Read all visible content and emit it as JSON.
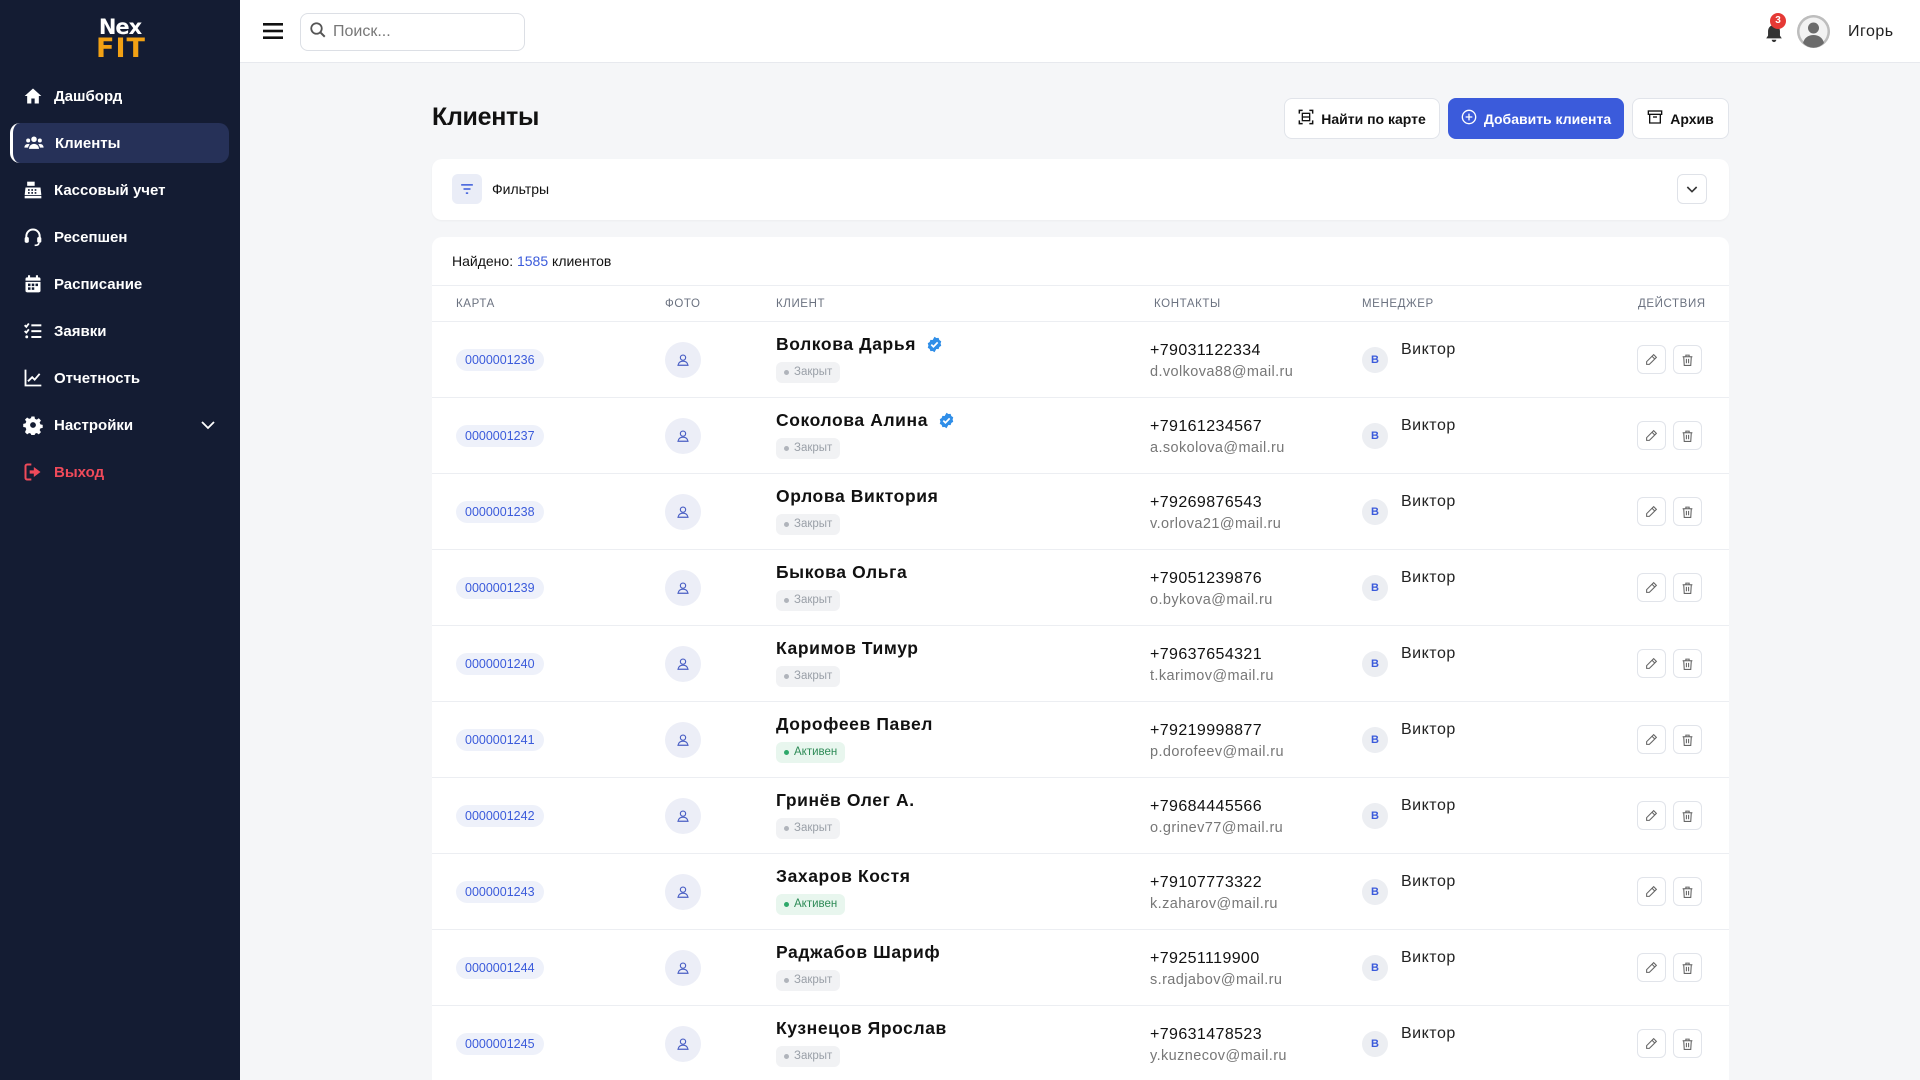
{
  "brand": {
    "line1": "Nex",
    "line2": "FIT"
  },
  "sidebar": {
    "items": [
      {
        "label": "Дашборд",
        "icon": "home-icon"
      },
      {
        "label": "Клиенты",
        "icon": "users-icon",
        "active": true
      },
      {
        "label": "Кассовый учет",
        "icon": "cash-register-icon"
      },
      {
        "label": "Ресепшен",
        "icon": "headset-icon"
      },
      {
        "label": "Расписание",
        "icon": "calendar-icon"
      },
      {
        "label": "Заявки",
        "icon": "list-check-icon"
      },
      {
        "label": "Отчетность",
        "icon": "chart-line-icon"
      },
      {
        "label": "Настройки",
        "icon": "gear-icon",
        "expandable": true
      },
      {
        "label": "Выход",
        "icon": "logout-icon"
      }
    ]
  },
  "topbar": {
    "search_placeholder": "Поиск...",
    "notifications_count": "3",
    "username": "Игорь"
  },
  "page": {
    "title": "Клиенты",
    "btn_find_card": "Найти по карте",
    "btn_add_client": "Добавить клиента",
    "btn_archive": "Архив"
  },
  "filters": {
    "label": "Фильтры"
  },
  "summary": {
    "prefix": "Найдено:",
    "count": "1585",
    "suffix": "клиентов"
  },
  "table": {
    "headers": {
      "card": "КАРТА",
      "photo": "ФОТО",
      "client": "КЛИЕНТ",
      "contacts": "КОНТАКТЫ",
      "manager": "МЕНЕДЖЕР",
      "actions": "ДЕЙСТВИЯ"
    },
    "rows": [
      {
        "card": "0000001236",
        "name": "Волкова Дарья",
        "verified": true,
        "status": "Закрыт",
        "status_type": "closed",
        "phone": "+79031122334",
        "email": "d.volkova88@mail.ru",
        "manager_initial": "В",
        "manager": "Виктор"
      },
      {
        "card": "0000001237",
        "name": "Соколова Алина",
        "verified": true,
        "status": "Закрыт",
        "status_type": "closed",
        "phone": "+79161234567",
        "email": "a.sokolova@mail.ru",
        "manager_initial": "В",
        "manager": "Виктор"
      },
      {
        "card": "0000001238",
        "name": "Орлова Виктория",
        "verified": false,
        "status": "Закрыт",
        "status_type": "closed",
        "phone": "+79269876543",
        "email": "v.orlova21@mail.ru",
        "manager_initial": "В",
        "manager": "Виктор"
      },
      {
        "card": "0000001239",
        "name": "Быкова Ольга",
        "verified": false,
        "status": "Закрыт",
        "status_type": "closed",
        "phone": "+79051239876",
        "email": "o.bykova@mail.ru",
        "manager_initial": "В",
        "manager": "Виктор"
      },
      {
        "card": "0000001240",
        "name": "Каримов Тимур",
        "verified": false,
        "status": "Закрыт",
        "status_type": "closed",
        "phone": "+79637654321",
        "email": "t.karimov@mail.ru",
        "manager_initial": "В",
        "manager": "Виктор"
      },
      {
        "card": "0000001241",
        "name": "Дорофеев Павел",
        "verified": false,
        "status": "Активен",
        "status_type": "active",
        "phone": "+79219998877",
        "email": "p.dorofeev@mail.ru",
        "manager_initial": "В",
        "manager": "Виктор"
      },
      {
        "card": "0000001242",
        "name": "Гринёв Олег А.",
        "verified": false,
        "status": "Закрыт",
        "status_type": "closed",
        "phone": "+79684445566",
        "email": "o.grinev77@mail.ru",
        "manager_initial": "В",
        "manager": "Виктор"
      },
      {
        "card": "0000001243",
        "name": "Захаров Костя",
        "verified": false,
        "status": "Активен",
        "status_type": "active",
        "phone": "+79107773322",
        "email": "k.zaharov@mail.ru",
        "manager_initial": "В",
        "manager": "Виктор"
      },
      {
        "card": "0000001244",
        "name": "Раджабов Шариф",
        "verified": false,
        "status": "Закрыт",
        "status_type": "closed",
        "phone": "+79251119900",
        "email": "s.radjabov@mail.ru",
        "manager_initial": "В",
        "manager": "Виктор"
      },
      {
        "card": "0000001245",
        "name": "Кузнецов Ярослав",
        "verified": false,
        "status": "Закрыт",
        "status_type": "closed",
        "phone": "+79631478523",
        "email": "y.kuznecov@mail.ru",
        "manager_initial": "В",
        "manager": "Виктор"
      }
    ]
  },
  "colors": {
    "sidebar_bg": "#141c33",
    "accent": "#3b5bdb",
    "brand_accent": "#f2a114",
    "logout": "#ef4a5a",
    "active_status": "#2e8b57"
  }
}
